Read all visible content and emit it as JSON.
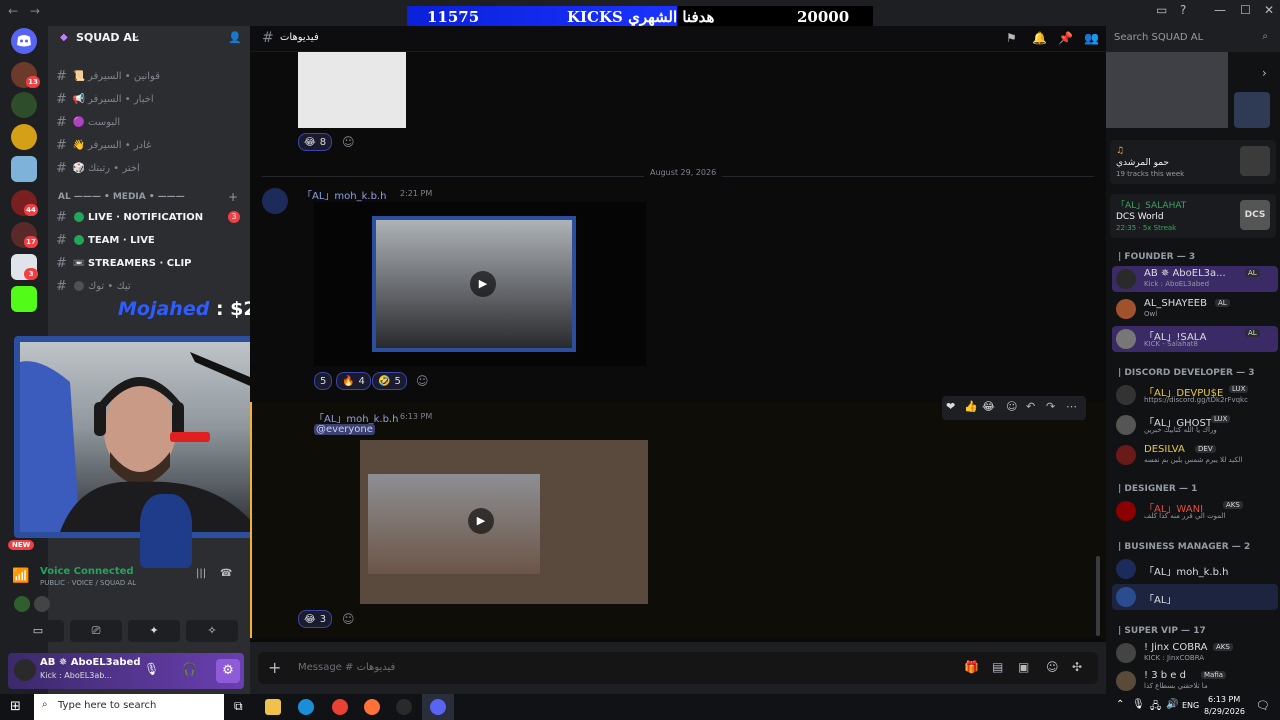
{
  "window": {
    "back": "←",
    "forward": "→"
  },
  "goal": {
    "current": "11575",
    "title": "KICKS هدفنا الشهري",
    "target": "20000",
    "progress": 0.58
  },
  "server": {
    "name": "SQUAD AL"
  },
  "rail_badges": [
    "13",
    "44",
    "17",
    "3"
  ],
  "channels_top": [
    {
      "emoji": "📜",
      "label": "قوانين • السيرفر"
    },
    {
      "emoji": "📢",
      "label": "اخبار • السيرفر"
    },
    {
      "emoji": "🟣",
      "label": "البوست"
    },
    {
      "emoji": "👋",
      "label": "غادر • السيرفر"
    },
    {
      "emoji": "🎲",
      "label": "اختر • رتبتك"
    }
  ],
  "media_category": "AL ——— • MEDIA • ———",
  "media_channels": [
    {
      "label": "LIVE · NOTIFICATION",
      "badge": "3"
    },
    {
      "label": "TEAM · LIVE"
    },
    {
      "label": "STREAMERS · CLIP"
    },
    {
      "label": "تيك • توك"
    }
  ],
  "donation": {
    "name": "Mojahed",
    "amount": ": $2"
  },
  "voice": {
    "status": "Voice Connected",
    "channel": "PUBLIC · VOICE / SQUAD AL"
  },
  "user": {
    "name": "AB ✵ AboEL3abed",
    "status": "Kick : AboEL3ab..."
  },
  "new_badge": "NEW",
  "chat": {
    "channel": "فيديوهات",
    "date_divider": "August 29, 2026",
    "msg1": {
      "author": "「AL」moh_k.b.h",
      "time": "2:21 PM"
    },
    "msg2": {
      "author": "「AL」moh_k.b.h",
      "time": "6:13 PM",
      "mention": "@everyone"
    },
    "react_top": "8",
    "react_mid": [
      "5",
      "4",
      "5"
    ],
    "react_bottom": "3",
    "placeholder": "Message # فيديوهات"
  },
  "search": {
    "placeholder": "Search SQUAD AL"
  },
  "activity": [
    {
      "name": "حمو المرشدي",
      "sub": "19 tracks this week"
    },
    {
      "name": "DCS World",
      "sub": "22:35 · 5x Streak",
      "title": "「AL」SALAHAT"
    }
  ],
  "roles": [
    {
      "title": "| FOUNDER — 3",
      "members": [
        {
          "name": "AB ✵ AboEL3a...",
          "tag": "AL",
          "status": "Kick : AboEL3abed",
          "color": "#f0f0f0"
        },
        {
          "name": "AL_SHAYEEB",
          "tag": "AL",
          "status": "Owl",
          "color": "#e8c84a"
        },
        {
          "name": "「AL」!SALA",
          "tag": "AL",
          "status": "KICK - Salahat8",
          "color": "#f0f0f0"
        }
      ]
    },
    {
      "title": "| DISCORD DEVELOPER — 3",
      "members": [
        {
          "name": "「AL」DEVPU$E",
          "tag": "LUX",
          "status": "https://discord.gg/tDk2rFvqkc",
          "color": "#e8c84a"
        },
        {
          "name": "「AL」GHOST",
          "tag": "LUX",
          "status": "وراك يا الله كتابيك خبرين",
          "color": "#f0f0f0"
        },
        {
          "name": "DESILVA",
          "tag": "DEV",
          "status": "الكيد للا يبرم شمس يلين بم نفسه",
          "color": "#e8c84a"
        }
      ]
    },
    {
      "title": "| DESIGNER — 1",
      "members": [
        {
          "name": "「AL」WANI",
          "tag": "AKS",
          "status": "الموت الي قرر منه كذا كلف",
          "color": "#e74c3c"
        }
      ]
    },
    {
      "title": "| BUSINESS MANAGER — 2",
      "members": [
        {
          "name": "「AL」moh_k.b.h",
          "status": "",
          "color": "#f0f0f0"
        },
        {
          "name": "「AL」",
          "status": "",
          "color": "#f0f0f0"
        }
      ]
    },
    {
      "title": "| SUPER VIP — 17",
      "members": [
        {
          "name": "! Jinx COBRA",
          "tag": "AKS",
          "status": "KICK : JinxCOBRA",
          "color": "#f0f0f0"
        },
        {
          "name": "! 3 b e d",
          "tag": "Mafia",
          "status": "ما تلاحقني بسطاع كذا",
          "color": "#f0f0f0"
        }
      ]
    }
  ],
  "taskbar": {
    "search": "Type here to search",
    "lang": "ENG",
    "time": "6:13 PM",
    "date": "8/29/2026"
  }
}
